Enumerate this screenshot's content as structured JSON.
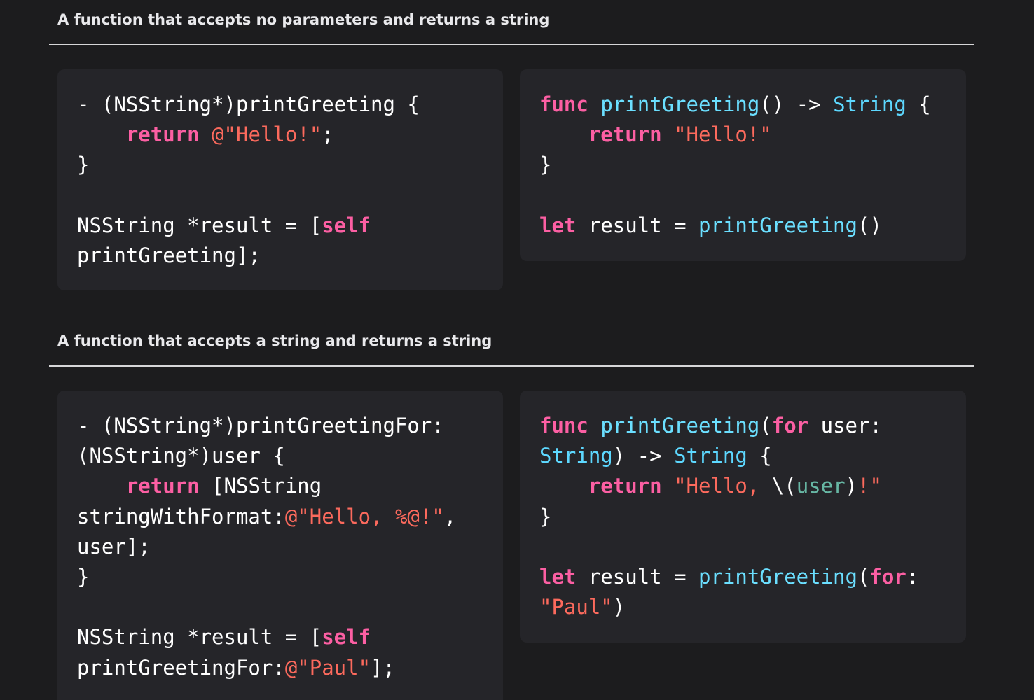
{
  "colors": {
    "background": "#1c1c1e",
    "panel": "#252529",
    "keyword": "#fc5fa3",
    "string": "#fc6a5d",
    "function": "#6bdfff",
    "type": "#5dd8ff",
    "variable": "#67b7a4",
    "plain": "#ffffff"
  },
  "sections": [
    {
      "title": "A function that accepts no parameters and returns a string",
      "objc": {
        "lines": [
          [
            {
              "t": "pl",
              "v": "- (NSString*)printGreeting {"
            }
          ],
          [
            {
              "t": "pl",
              "v": "    "
            },
            {
              "t": "kw",
              "v": "return"
            },
            {
              "t": "pl",
              "v": " "
            },
            {
              "t": "str",
              "v": "@\"Hello!\""
            },
            {
              "t": "pl",
              "v": ";"
            }
          ],
          [
            {
              "t": "pl",
              "v": "}"
            }
          ],
          [
            {
              "t": "pl",
              "v": ""
            }
          ],
          [
            {
              "t": "pl",
              "v": "NSString *result = ["
            },
            {
              "t": "kw",
              "v": "self"
            }
          ],
          [
            {
              "t": "pl",
              "v": "printGreeting];"
            }
          ]
        ]
      },
      "swift": {
        "lines": [
          [
            {
              "t": "kw",
              "v": "func"
            },
            {
              "t": "pl",
              "v": " "
            },
            {
              "t": "fn",
              "v": "printGreeting"
            },
            {
              "t": "pl",
              "v": "() -> "
            },
            {
              "t": "typ",
              "v": "String"
            },
            {
              "t": "pl",
              "v": " {"
            }
          ],
          [
            {
              "t": "pl",
              "v": "    "
            },
            {
              "t": "kw",
              "v": "return"
            },
            {
              "t": "pl",
              "v": " "
            },
            {
              "t": "str",
              "v": "\"Hello!\""
            }
          ],
          [
            {
              "t": "pl",
              "v": "}"
            }
          ],
          [
            {
              "t": "pl",
              "v": ""
            }
          ],
          [
            {
              "t": "kw",
              "v": "let"
            },
            {
              "t": "pl",
              "v": " result = "
            },
            {
              "t": "fn",
              "v": "printGreeting"
            },
            {
              "t": "pl",
              "v": "()"
            }
          ]
        ]
      }
    },
    {
      "title": "A function that accepts a string and returns a string",
      "objc": {
        "lines": [
          [
            {
              "t": "pl",
              "v": "- (NSString*)printGreetingFor:"
            }
          ],
          [
            {
              "t": "pl",
              "v": "(NSString*)user {"
            }
          ],
          [
            {
              "t": "pl",
              "v": "    "
            },
            {
              "t": "kw",
              "v": "return"
            },
            {
              "t": "pl",
              "v": " [NSString"
            }
          ],
          [
            {
              "t": "pl",
              "v": "stringWithFormat:"
            },
            {
              "t": "str",
              "v": "@\"Hello, %@!\""
            },
            {
              "t": "pl",
              "v": ","
            }
          ],
          [
            {
              "t": "pl",
              "v": "user];"
            }
          ],
          [
            {
              "t": "pl",
              "v": "}"
            }
          ],
          [
            {
              "t": "pl",
              "v": ""
            }
          ],
          [
            {
              "t": "pl",
              "v": "NSString *result = ["
            },
            {
              "t": "kw",
              "v": "self"
            }
          ],
          [
            {
              "t": "pl",
              "v": "printGreetingFor:"
            },
            {
              "t": "str",
              "v": "@\"Paul\""
            },
            {
              "t": "pl",
              "v": "];"
            }
          ]
        ]
      },
      "swift": {
        "lines": [
          [
            {
              "t": "kw",
              "v": "func"
            },
            {
              "t": "pl",
              "v": " "
            },
            {
              "t": "fn",
              "v": "printGreeting"
            },
            {
              "t": "pl",
              "v": "("
            },
            {
              "t": "kw",
              "v": "for"
            },
            {
              "t": "pl",
              "v": " user:"
            }
          ],
          [
            {
              "t": "typ",
              "v": "String"
            },
            {
              "t": "pl",
              "v": ") -> "
            },
            {
              "t": "typ",
              "v": "String"
            },
            {
              "t": "pl",
              "v": " {"
            }
          ],
          [
            {
              "t": "pl",
              "v": "    "
            },
            {
              "t": "kw",
              "v": "return"
            },
            {
              "t": "pl",
              "v": " "
            },
            {
              "t": "str",
              "v": "\"Hello, "
            },
            {
              "t": "pl",
              "v": "\\("
            },
            {
              "t": "var",
              "v": "user"
            },
            {
              "t": "pl",
              "v": ")"
            },
            {
              "t": "str",
              "v": "!\""
            }
          ],
          [
            {
              "t": "pl",
              "v": "}"
            }
          ],
          [
            {
              "t": "pl",
              "v": ""
            }
          ],
          [
            {
              "t": "kw",
              "v": "let"
            },
            {
              "t": "pl",
              "v": " result = "
            },
            {
              "t": "fn",
              "v": "printGreeting"
            },
            {
              "t": "pl",
              "v": "("
            },
            {
              "t": "kw",
              "v": "for"
            },
            {
              "t": "pl",
              "v": ":"
            }
          ],
          [
            {
              "t": "str",
              "v": "\"Paul\""
            },
            {
              "t": "pl",
              "v": ")"
            }
          ]
        ]
      }
    }
  ]
}
